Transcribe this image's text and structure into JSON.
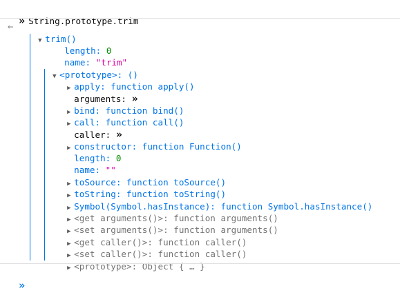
{
  "input_line": {
    "chevron": "»",
    "command": "String.prototype.trim"
  },
  "result": {
    "back_arrow": "←",
    "root": "trim()",
    "props": {
      "length_key": "length: ",
      "length_val": "0",
      "name_key": "name: ",
      "name_val": "\"trim\""
    },
    "proto_label": "<prototype>: ()",
    "items": [
      {
        "key": "apply: ",
        "val": "function apply()"
      },
      {
        "key": "arguments: ",
        "val": "»"
      },
      {
        "key": "bind: ",
        "val": "function bind()"
      },
      {
        "key": "call: ",
        "val": "function call()"
      },
      {
        "key": "caller: ",
        "val": "»"
      },
      {
        "key": "constructor: ",
        "val": "function Function()"
      },
      {
        "key": "length: ",
        "val": "0"
      },
      {
        "key": "name: ",
        "val": "\"\""
      },
      {
        "key": "toSource: ",
        "val": "function toSource()"
      },
      {
        "key": "toString: ",
        "val": "function toString()"
      },
      {
        "key": "Symbol(Symbol.hasInstance): ",
        "val": "function Symbol.hasInstance()"
      },
      {
        "key": "<get arguments()>: ",
        "val": "function arguments()"
      },
      {
        "key": "<set arguments()>: ",
        "val": "function arguments()"
      },
      {
        "key": "<get caller()>: ",
        "val": "function caller()"
      },
      {
        "key": "<set caller()>: ",
        "val": "function caller()"
      },
      {
        "key": "<prototype>: ",
        "val": "Object { … }"
      }
    ]
  },
  "prompt": {
    "chevron": "»"
  },
  "colors": {
    "key": "#0074e8",
    "string": "#dd00a9",
    "number": "#058b00",
    "accessor": "#737373"
  }
}
